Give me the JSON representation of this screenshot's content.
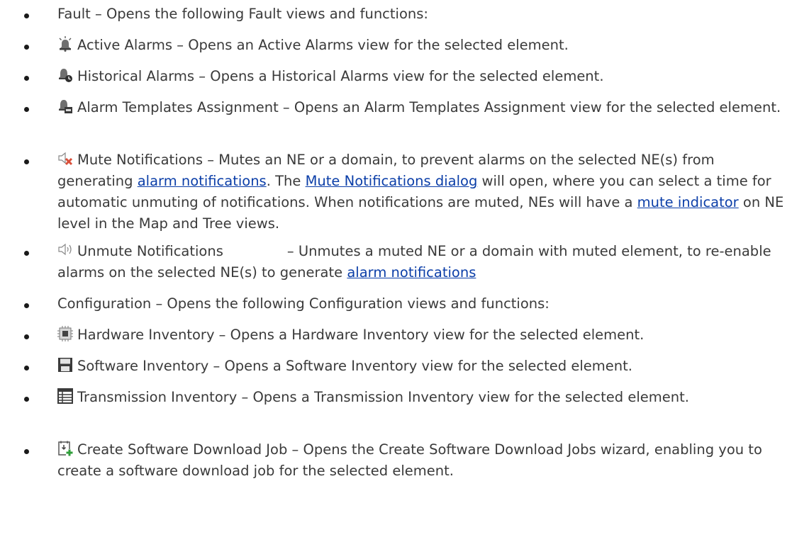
{
  "items": [
    {
      "icon": "",
      "text": "Fault – Opens the following Fault views and functions:"
    },
    {
      "icon": "bell-alarm-icon",
      "text": "Active Alarms – Opens an Active Alarms view for the selected element."
    },
    {
      "icon": "historical-alarm-icon",
      "text": "Historical Alarms – Opens a Historical Alarms view for the selected element."
    },
    {
      "icon": "alarm-template-icon",
      "text": "Alarm Templates Assignment – Opens an Alarm Templates Assignment view for the selected element."
    },
    {
      "icon": "mute-speaker-icon",
      "t1": "Mute Notifications – Mutes an NE or a domain, to prevent alarms on the selected NE(s) from generating ",
      "l1": "alarm notifications",
      "t2": ". The ",
      "l2": "Mute Notifications dialog",
      "t3": " will open, where you can select a time for automatic unmuting of notifications. When notifications are muted, NEs will have a ",
      "l3": "mute indicator",
      "t4": " on NE level in the Map and Tree views."
    },
    {
      "icon": "unmute-speaker-icon",
      "t1": "Unmute Notifications",
      "t2": "– Unmutes a muted NE or a domain with muted element, to re-enable alarms on the selected NE(s) to generate ",
      "l1": "alarm notifications"
    },
    {
      "icon": "",
      "text": "Configuration – Opens the following Configuration views and functions:"
    },
    {
      "icon": "hardware-chip-icon",
      "text": "Hardware Inventory – Opens a Hardware Inventory view for the selected element."
    },
    {
      "icon": "floppy-disk-icon",
      "text": "Software Inventory – Opens a Software Inventory view for the selected element."
    },
    {
      "icon": "table-grid-icon",
      "text": "Transmission Inventory – Opens a Transmission Inventory view for the selected element."
    },
    {
      "icon": "download-job-icon",
      "text": "Create Software Download Job – Opens the Create Software Download Jobs wizard, enabling you to create a software download job for the selected element."
    }
  ]
}
